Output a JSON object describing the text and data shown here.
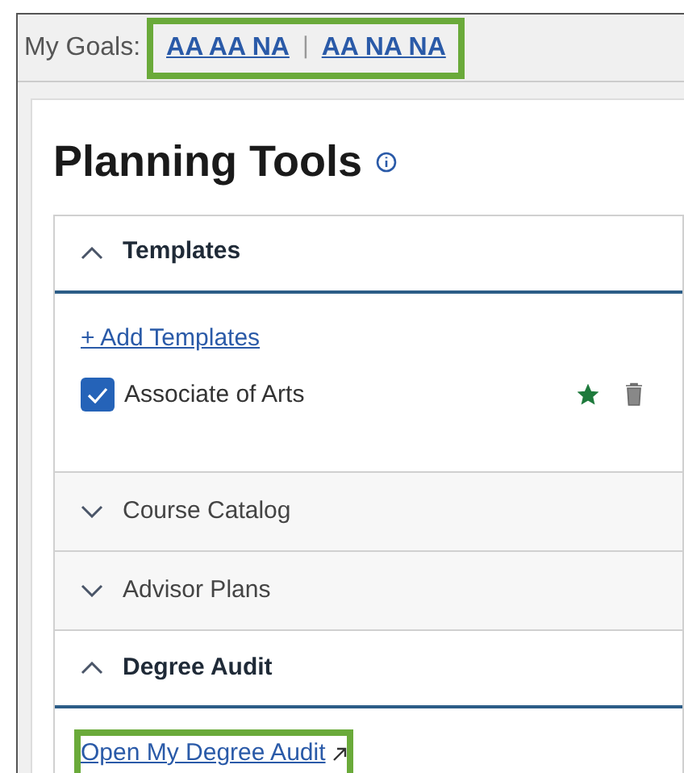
{
  "goals": {
    "label": "My Goals:",
    "highlighted": true,
    "links": [
      "AA AA NA",
      "AA NA NA"
    ],
    "separator": "|"
  },
  "title": "Planning Tools",
  "sections": [
    {
      "title": "Templates",
      "expanded": true,
      "kind": "templates",
      "add_link": "+ Add Templates",
      "items": [
        {
          "label": "Associate of Arts",
          "checked": true,
          "favorite": true
        }
      ]
    },
    {
      "title": "Course Catalog",
      "expanded": false
    },
    {
      "title": "Advisor Plans",
      "expanded": false
    },
    {
      "title": "Degree Audit",
      "expanded": true,
      "kind": "link",
      "link": "Open My Degree Audit",
      "highlighted": true
    }
  ]
}
